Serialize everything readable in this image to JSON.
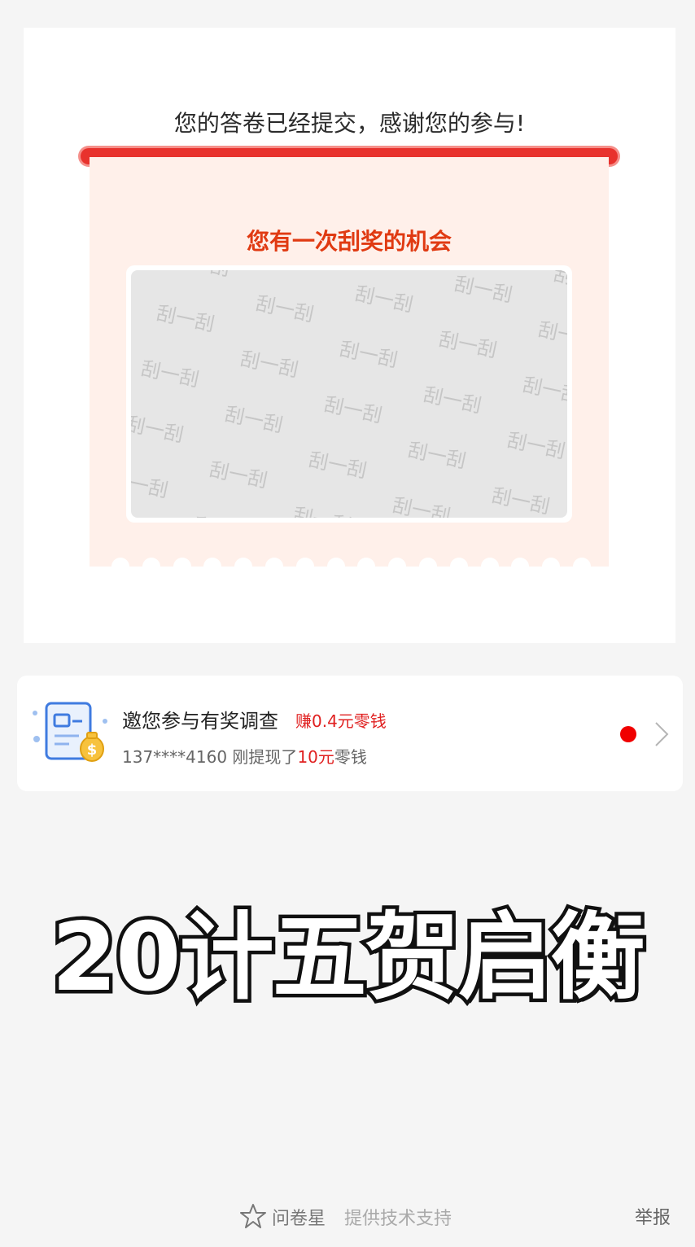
{
  "result": {
    "thank_you": "您的答卷已经提交，感谢您的参与!"
  },
  "scratch": {
    "title": "您有一次刮奖的机会",
    "watermark": "刮一刮"
  },
  "promo": {
    "title": "邀您参与有奖调查",
    "reward": "赚0.4元零钱",
    "sub_prefix": "137****4160 刚提现了",
    "sub_amount": "10元",
    "sub_suffix": "零钱"
  },
  "overlay": {
    "text": "20计五贺启衡"
  },
  "footer": {
    "brand": "问卷星",
    "support": "提供技术支持",
    "report": "举报"
  },
  "colors": {
    "accent_red": "#e8322d",
    "title_orange": "#e03a12",
    "ticket_bg": "#fff0ea"
  }
}
